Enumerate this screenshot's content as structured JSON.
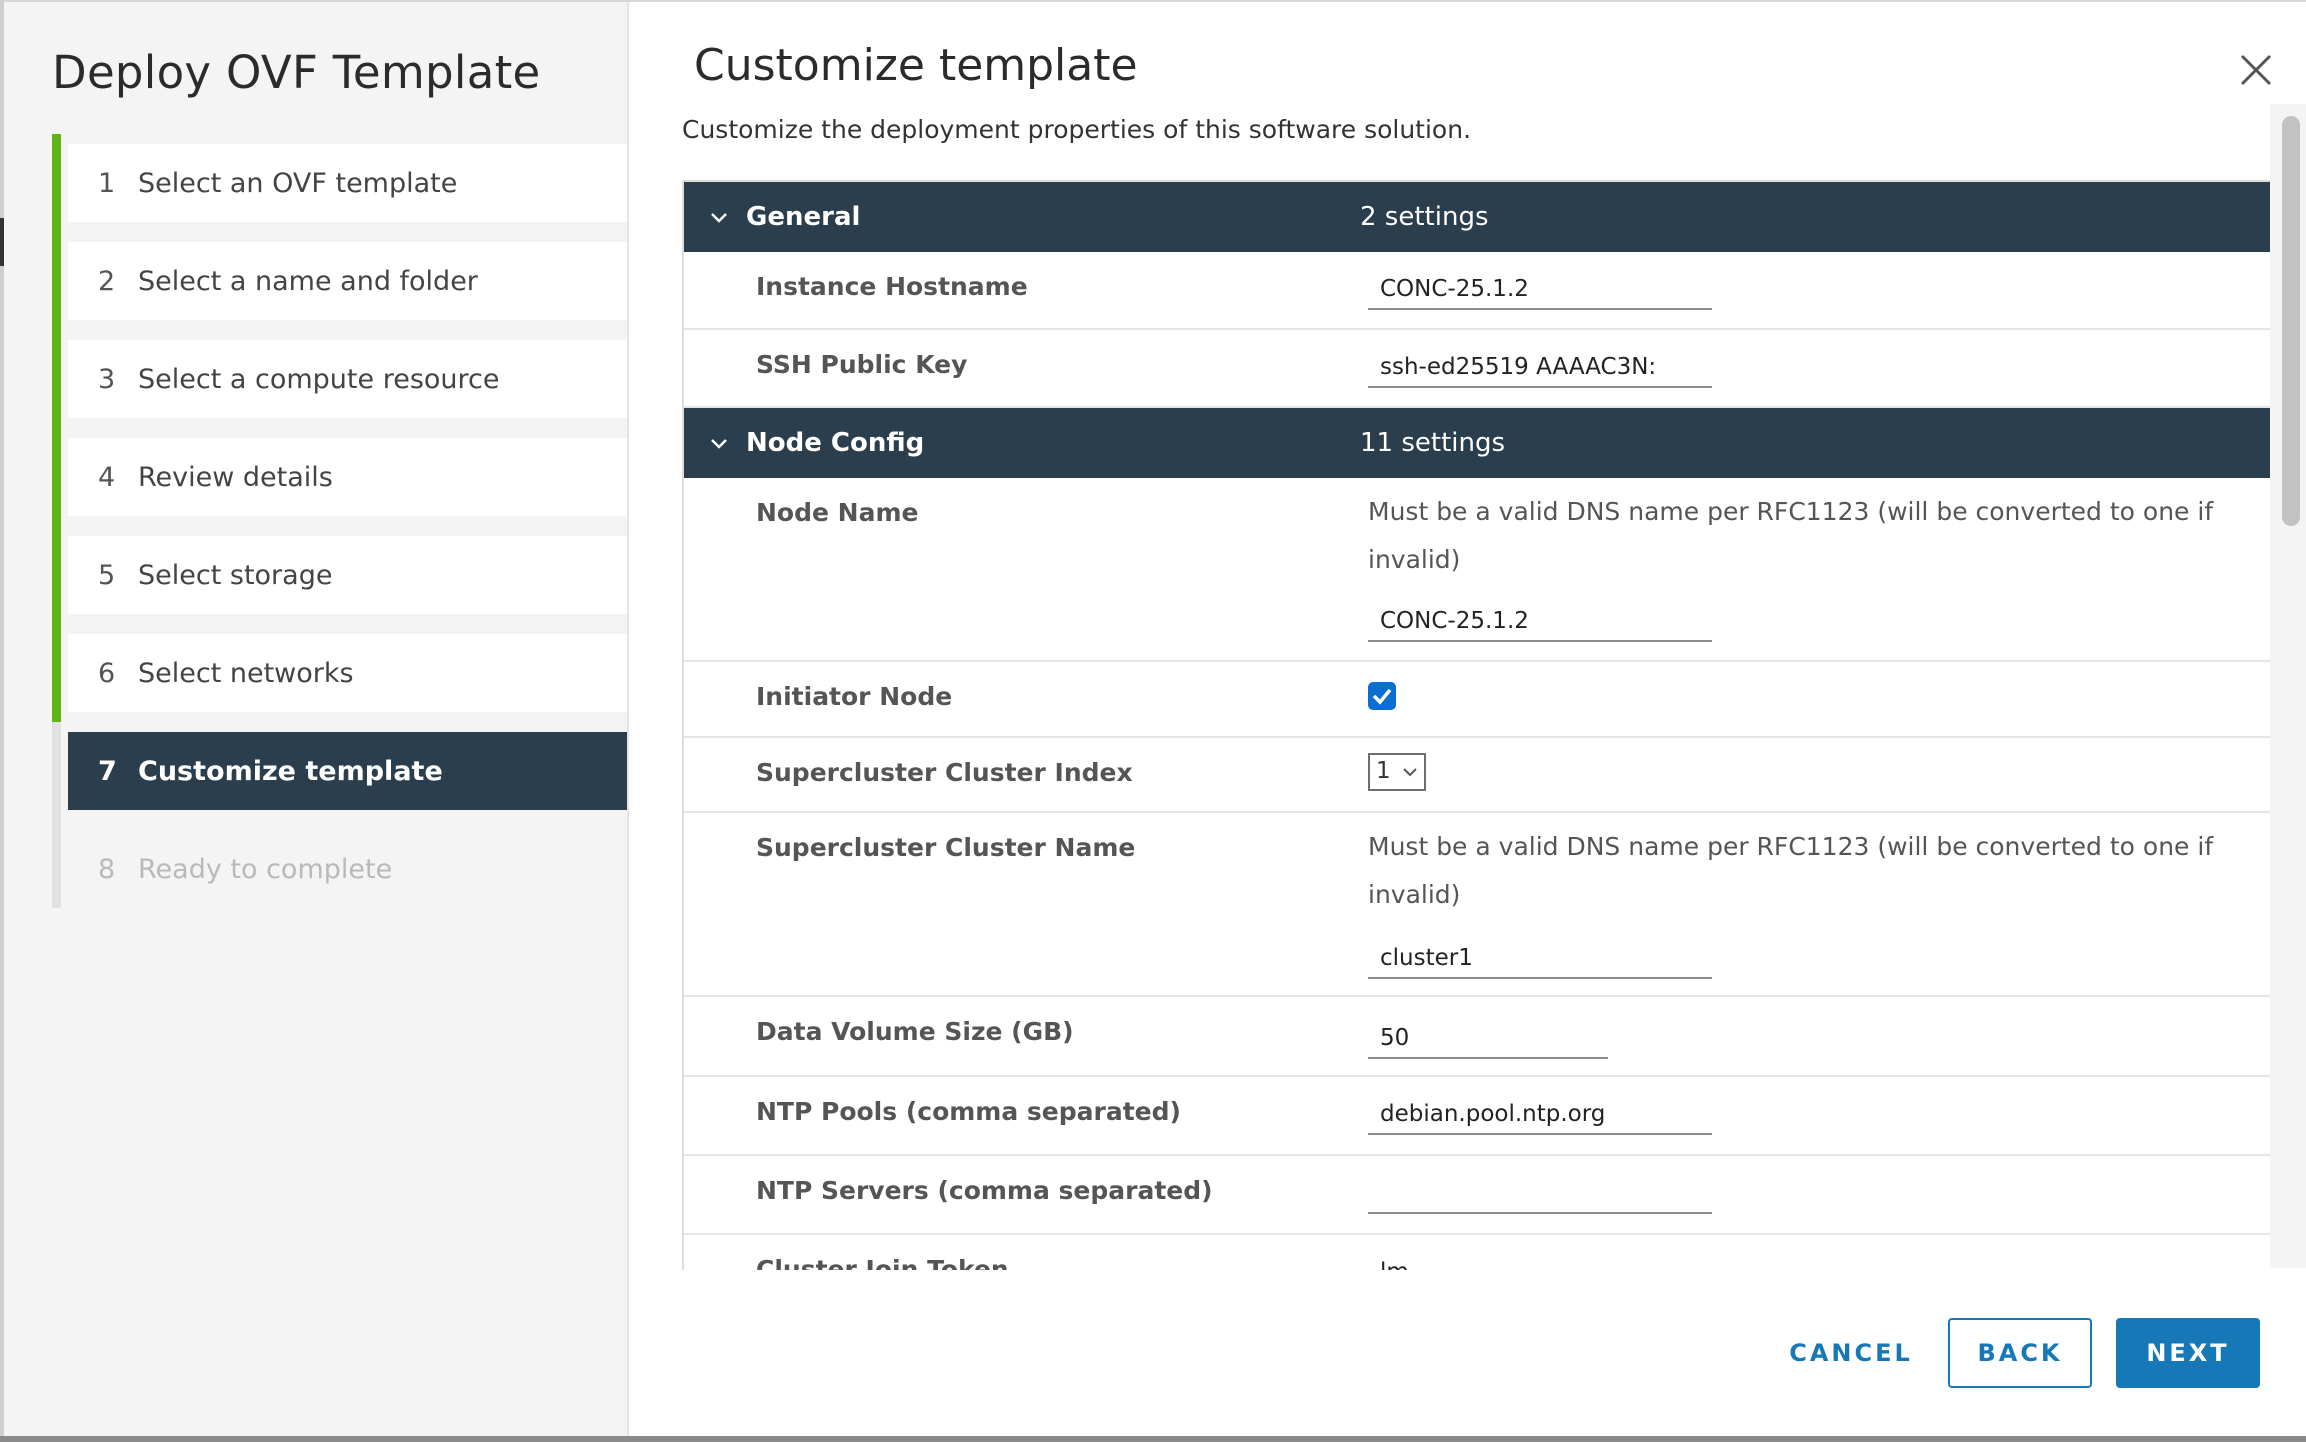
{
  "wizard": {
    "title": "Deploy OVF Template",
    "steps": [
      {
        "num": "1",
        "label": "Select an OVF template",
        "state": "done"
      },
      {
        "num": "2",
        "label": "Select a name and folder",
        "state": "done"
      },
      {
        "num": "3",
        "label": "Select a compute resource",
        "state": "done"
      },
      {
        "num": "4",
        "label": "Review details",
        "state": "done"
      },
      {
        "num": "5",
        "label": "Select storage",
        "state": "done"
      },
      {
        "num": "6",
        "label": "Select networks",
        "state": "done"
      },
      {
        "num": "7",
        "label": "Customize template",
        "state": "active"
      },
      {
        "num": "8",
        "label": "Ready to complete",
        "state": "disabled"
      }
    ]
  },
  "page": {
    "title": "Customize template",
    "subtitle": "Customize the deployment properties of this software solution."
  },
  "sections": {
    "general": {
      "name": "General",
      "count": "2 settings",
      "hostname_label": "Instance Hostname",
      "hostname_value": "CONC-25.1.2",
      "ssh_label": "SSH Public Key",
      "ssh_value": "ssh-ed25519 AAAAC3N:"
    },
    "node_config": {
      "name": "Node Config",
      "count": "11 settings",
      "node_name_label": "Node Name",
      "node_name_help": "Must be a valid DNS name per RFC1123 (will be converted to one if invalid)",
      "node_name_value": "CONC-25.1.2",
      "initiator_label": "Initiator Node",
      "initiator_checked": true,
      "index_label": "Supercluster Cluster Index",
      "index_value": "1",
      "cluster_name_label": "Supercluster Cluster Name",
      "cluster_name_help": "Must be a valid DNS name per RFC1123 (will be converted to one if invalid)",
      "cluster_name_value": "cluster1",
      "data_volume_label": "Data Volume Size (GB)",
      "data_volume_value": "50",
      "ntp_pools_label": "NTP Pools (comma separated)",
      "ntp_pools_value": "debian.pool.ntp.org",
      "ntp_servers_label": "NTP Servers (comma separated)",
      "ntp_servers_value": "",
      "join_token_label": "Cluster Join Token",
      "join_token_value": "lm"
    }
  },
  "footer": {
    "cancel": "CANCEL",
    "back": "BACK",
    "next": "NEXT"
  },
  "colors": {
    "accent_green": "#60b515",
    "header_dark": "#2b3e4d",
    "button_blue": "#1678b6",
    "checkbox_blue": "#0b6fd1"
  }
}
